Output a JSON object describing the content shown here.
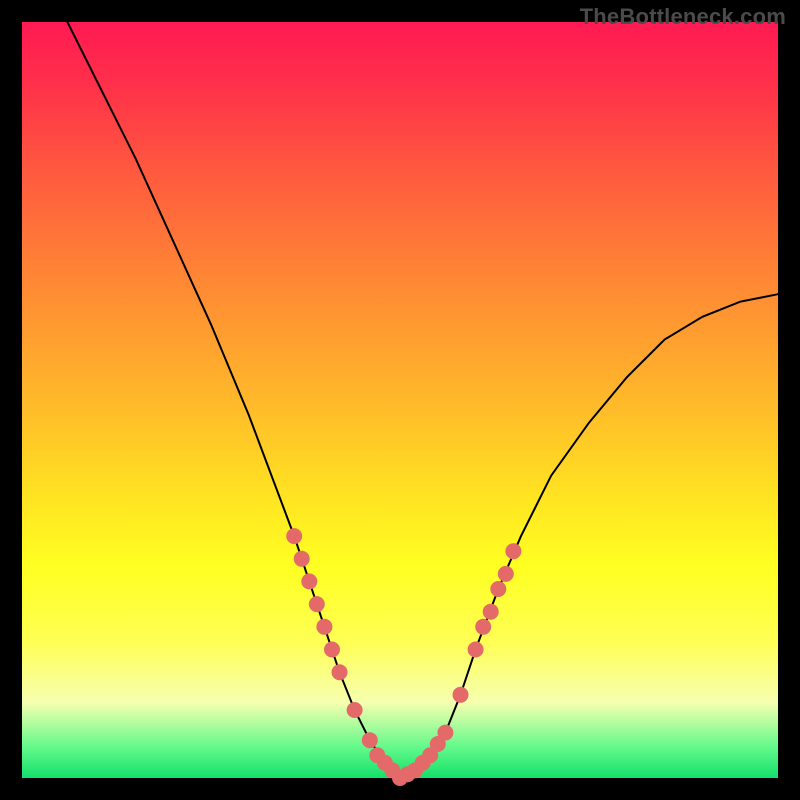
{
  "watermark": "TheBottleneck.com",
  "chart_data": {
    "type": "line",
    "title": "",
    "xlabel": "",
    "ylabel": "",
    "xlim": [
      0,
      100
    ],
    "ylim": [
      0,
      100
    ],
    "grid": false,
    "legend": false,
    "series": [
      {
        "name": "bottleneck-curve",
        "description": "V-shaped bottleneck percentage curve with minimum near x≈50",
        "x": [
          6,
          10,
          15,
          20,
          25,
          30,
          33,
          36,
          38,
          40,
          42,
          44,
          46,
          48,
          50,
          52,
          54,
          56,
          58,
          60,
          63,
          66,
          70,
          75,
          80,
          85,
          90,
          95,
          100
        ],
        "y": [
          100,
          92,
          82,
          71,
          60,
          48,
          40,
          32,
          26,
          20,
          14,
          9,
          5,
          2,
          0,
          1,
          3,
          6,
          11,
          17,
          25,
          32,
          40,
          47,
          53,
          58,
          61,
          63,
          64
        ]
      }
    ],
    "markers": {
      "name": "highlighted-points-near-minimum",
      "color": "#e46a6a",
      "points": [
        {
          "x": 36,
          "y": 32
        },
        {
          "x": 37,
          "y": 29
        },
        {
          "x": 38,
          "y": 26
        },
        {
          "x": 39,
          "y": 23
        },
        {
          "x": 40,
          "y": 20
        },
        {
          "x": 41,
          "y": 17
        },
        {
          "x": 42,
          "y": 14
        },
        {
          "x": 44,
          "y": 9
        },
        {
          "x": 46,
          "y": 5
        },
        {
          "x": 47,
          "y": 3
        },
        {
          "x": 48,
          "y": 2
        },
        {
          "x": 49,
          "y": 1
        },
        {
          "x": 50,
          "y": 0
        },
        {
          "x": 51,
          "y": 0.5
        },
        {
          "x": 52,
          "y": 1
        },
        {
          "x": 53,
          "y": 2
        },
        {
          "x": 54,
          "y": 3
        },
        {
          "x": 55,
          "y": 4.5
        },
        {
          "x": 56,
          "y": 6
        },
        {
          "x": 58,
          "y": 11
        },
        {
          "x": 60,
          "y": 17
        },
        {
          "x": 61,
          "y": 20
        },
        {
          "x": 62,
          "y": 22
        },
        {
          "x": 63,
          "y": 25
        },
        {
          "x": 64,
          "y": 27
        },
        {
          "x": 65,
          "y": 30
        }
      ]
    }
  }
}
